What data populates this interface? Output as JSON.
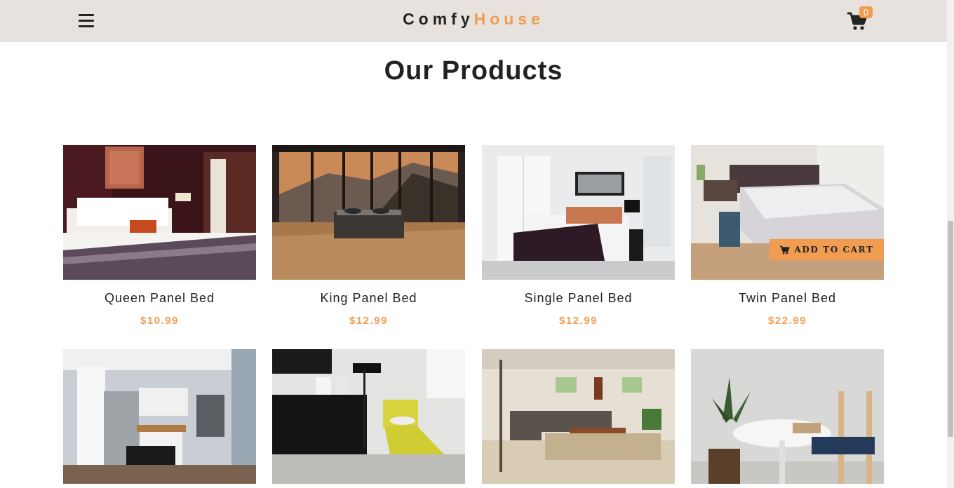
{
  "navbar": {
    "logo_part1": "Comfy",
    "logo_part2": "House",
    "cart_count": "0"
  },
  "section_title": "Our Products",
  "add_to_cart_label": "ADD TO CART",
  "products": [
    {
      "name": "Queen Panel Bed",
      "price": "$10.99"
    },
    {
      "name": "King Panel Bed",
      "price": "$12.99"
    },
    {
      "name": "Single Panel Bed",
      "price": "$12.99"
    },
    {
      "name": "Twin Panel Bed",
      "price": "$22.99"
    }
  ],
  "colors": {
    "accent": "#f09d51",
    "navbar_bg": "#e7e2dd",
    "text": "#222222"
  }
}
